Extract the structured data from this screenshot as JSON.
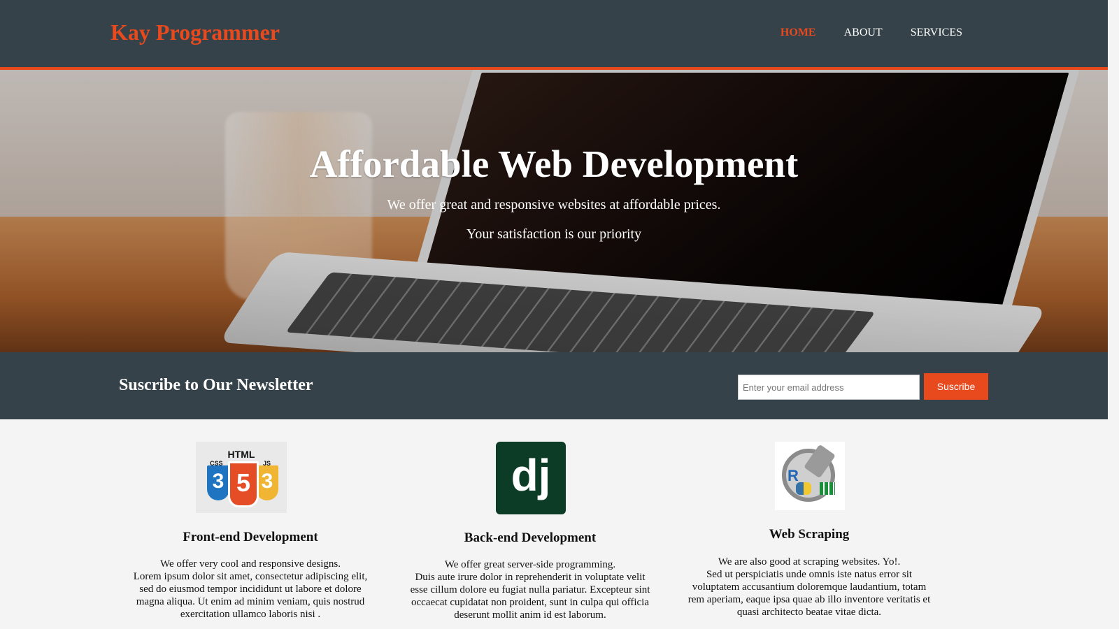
{
  "header": {
    "brand": "Kay Programmer",
    "nav": [
      {
        "label": "HOME",
        "current": true
      },
      {
        "label": "ABOUT",
        "current": false
      },
      {
        "label": "SERVICES",
        "current": false
      }
    ]
  },
  "hero": {
    "title": "Affordable Web Development",
    "line1": "We offer great and responsive websites at affordable prices.",
    "line2": "Your satisfaction is our priority"
  },
  "newsletter": {
    "heading": "Suscribe to Our Newsletter",
    "email_placeholder": "Enter your email address",
    "button_label": "Suscribe"
  },
  "services": [
    {
      "icon": "html-css-js-logo",
      "logo_text": [
        "HTML",
        "CSS",
        "JS",
        "3",
        "5",
        "3"
      ],
      "title": "Front-end Development",
      "lines": [
        "We offer very cool and responsive designs.",
        "Lorem ipsum dolor sit amet, consectetur adipiscing elit,",
        "sed do eiusmod tempor incididunt ut labore et dolore",
        "magna aliqua. Ut enim ad minim veniam, quis nostrud",
        "exercitation ullamco laboris nisi ."
      ]
    },
    {
      "icon": "django-logo",
      "logo_text": [
        "dj"
      ],
      "title": "Back-end Development",
      "lines": [
        "We offer great server-side programming.",
        "Duis aute irure dolor in reprehenderit in voluptate velit",
        "esse cillum dolore eu fugiat nulla pariatur. Excepteur sint",
        "occaecat cupidatat non proident, sunt in culpa qui officia",
        "deserunt mollit anim id est laborum."
      ]
    },
    {
      "icon": "web-scraping-logo",
      "logo_text": [
        "R"
      ],
      "title": "Web Scraping",
      "lines": [
        "We are also good at scraping websites. Yo!.",
        "Sed ut perspiciatis unde omnis iste natus error sit",
        "voluptatem accusantium doloremque laudantium, totam",
        "rem aperiam, eaque ipsa quae ab illo inventore veritatis et",
        "quasi architecto beatae vitae dicta."
      ]
    }
  ],
  "colors": {
    "header_bg": "#35424a",
    "accent": "#e8491d",
    "page_bg": "#f4f4f4"
  }
}
